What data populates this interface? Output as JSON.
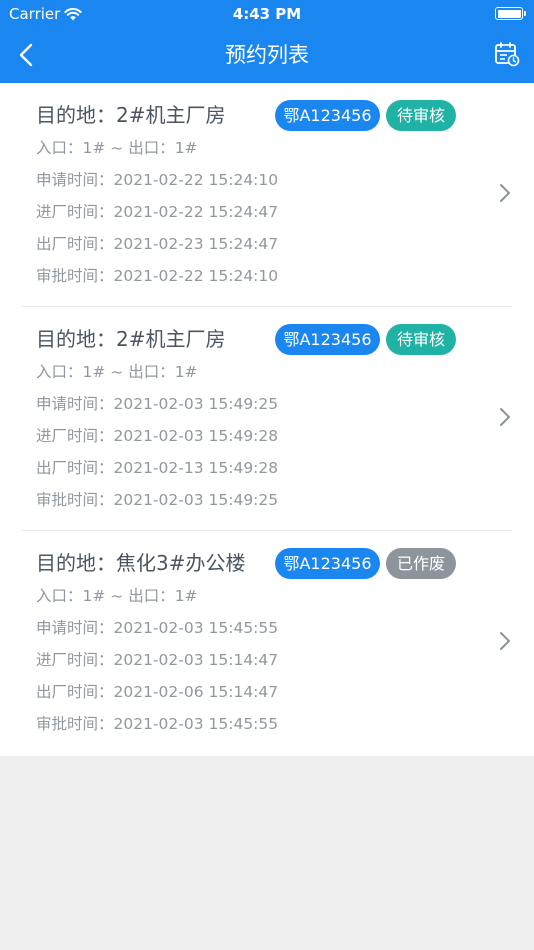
{
  "status": {
    "carrier": "Carrier",
    "time": "4:43 PM"
  },
  "header": {
    "title": "预约列表"
  },
  "colors": {
    "primary": "#1a86f0",
    "pending": "#21b2a6",
    "void": "#8e949c"
  },
  "records": [
    {
      "destination": "目的地：2#机主厂房",
      "plate": "鄂A123456",
      "status": "待审核",
      "status_type": "pending",
      "gates": "入口：1# ~ 出口：1#",
      "apply_time": "申请时间：2021-02-22 15:24:10",
      "enter_time": "进厂时间：2021-02-22 15:24:47",
      "exit_time": "出厂时间：2021-02-23 15:24:47",
      "approve_time": "审批时间：2021-02-22 15:24:10"
    },
    {
      "destination": "目的地：2#机主厂房",
      "plate": "鄂A123456",
      "status": "待审核",
      "status_type": "pending",
      "gates": "入口：1# ~ 出口：1#",
      "apply_time": "申请时间：2021-02-03 15:49:25",
      "enter_time": "进厂时间：2021-02-03 15:49:28",
      "exit_time": "出厂时间：2021-02-13 15:49:28",
      "approve_time": "审批时间：2021-02-03 15:49:25"
    },
    {
      "destination": "目的地：焦化3#办公楼",
      "plate": "鄂A123456",
      "status": "已作废",
      "status_type": "void",
      "gates": "入口：1# ~ 出口：1#",
      "apply_time": "申请时间：2021-02-03 15:45:55",
      "enter_time": "进厂时间：2021-02-03 15:14:47",
      "exit_time": "出厂时间：2021-02-06 15:14:47",
      "approve_time": "审批时间：2021-02-03 15:45:55"
    }
  ]
}
